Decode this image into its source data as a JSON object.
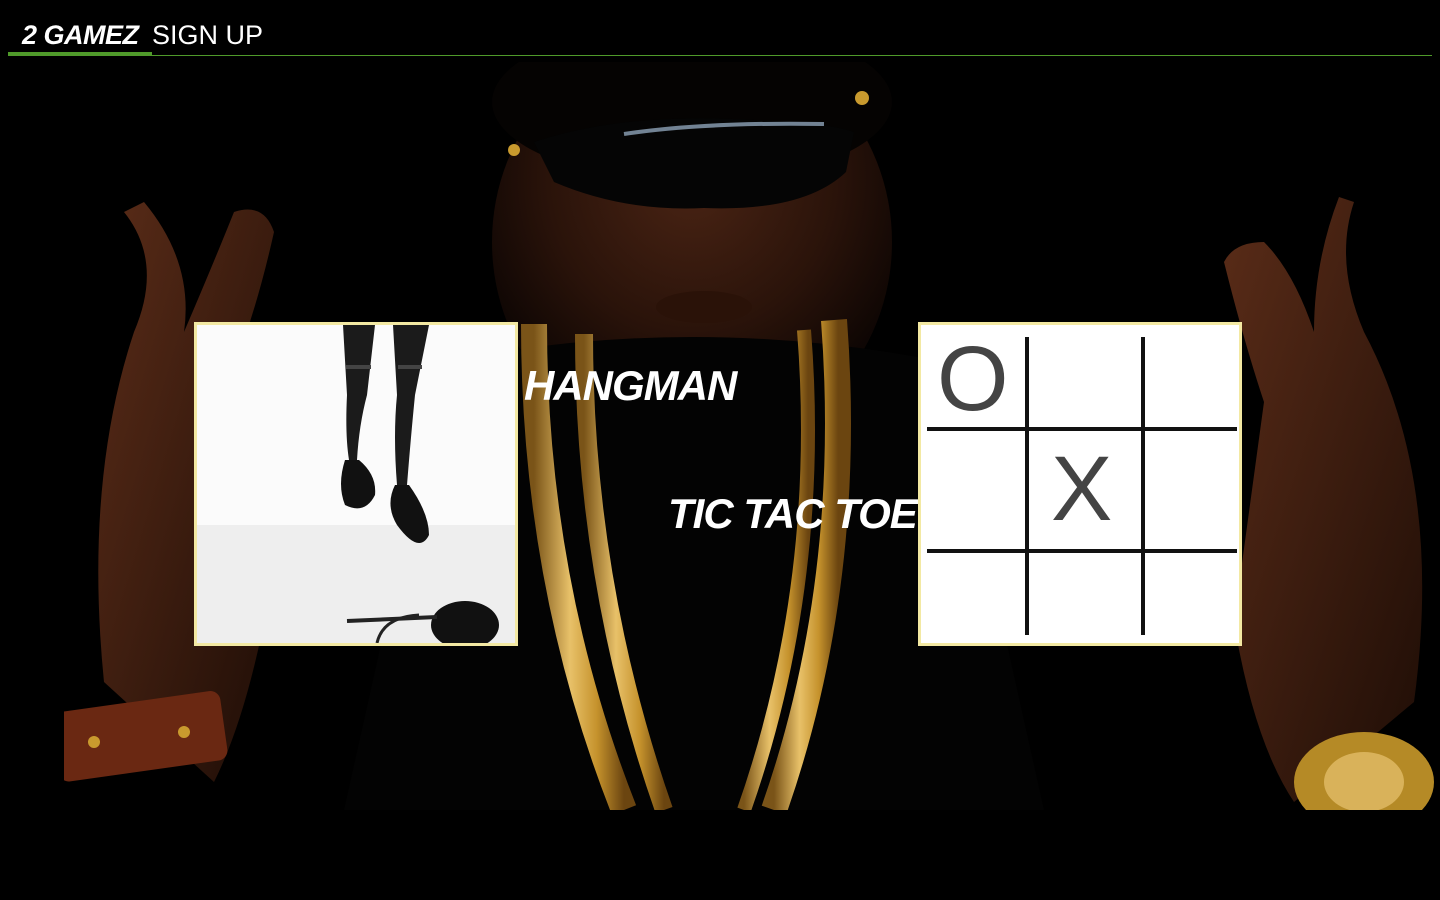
{
  "nav": {
    "brand": "2 GAMEZ",
    "signup": "SIGN UP"
  },
  "games": [
    {
      "label": "HANGMAN"
    },
    {
      "label": "TIC TAC TOE"
    }
  ],
  "tic_tac_toe_board": {
    "cells": [
      "O",
      "",
      "",
      "",
      "X",
      "",
      "",
      "",
      ""
    ]
  },
  "colors": {
    "background": "#000000",
    "nav_accent": "#4f9a2a",
    "tile_border": "#f3e9a3",
    "text": "#ffffff",
    "gold": "#c99a2e"
  }
}
